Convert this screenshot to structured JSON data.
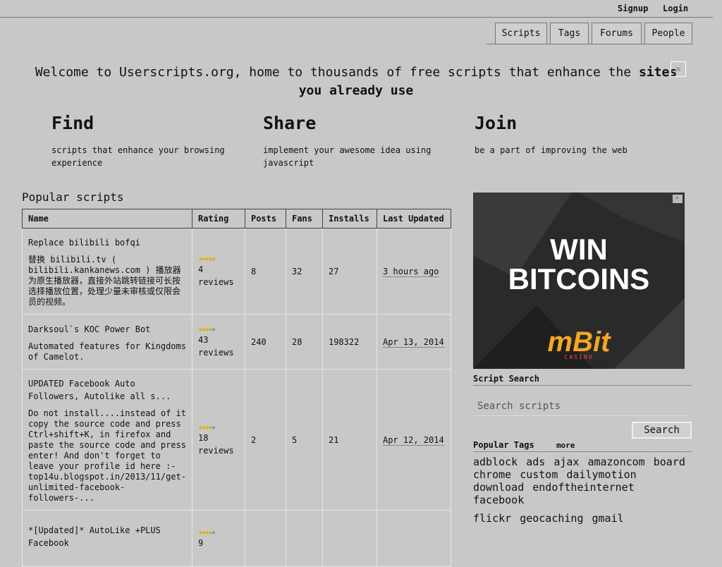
{
  "header": {
    "signup": "Signup",
    "login": "Login",
    "tabs": [
      "Scripts",
      "Tags",
      "Forums",
      "People"
    ]
  },
  "welcome": {
    "text_plain": "Welcome to Userscripts.org, home to thousands of free scripts that enhance the",
    "text_bold": "sites you already use",
    "close_glyph": "✕"
  },
  "features": [
    {
      "title": "Find",
      "desc": "scripts that enhance your browsing experience"
    },
    {
      "title": "Share",
      "desc": "implement your awesome idea using javascript"
    },
    {
      "title": "Join",
      "desc": "be a part of improving the web"
    }
  ],
  "popular": {
    "title": "Popular scripts",
    "columns": [
      "Name",
      "Rating",
      "Posts",
      "Fans",
      "Installs",
      "Last Updated"
    ],
    "rows": [
      {
        "name": "Replace bilibili bofqi",
        "desc": "替换 bilibili.tv ( bilibili.kankanews.com ) 播放器为原生播放器，直接外站跳转链接可长按选择播放位置，处理少量未审核或仅限会员的视频。",
        "rating": 5,
        "reviews": "4 reviews",
        "posts": "8",
        "fans": "32",
        "installs": "27",
        "updated": "3 hours ago"
      },
      {
        "name": "Darksoul`s KOC Power Bot",
        "desc": "Automated features for Kingdoms of Camelot.",
        "rating": 4,
        "reviews": "43 reviews",
        "posts": "240",
        "fans": "28",
        "installs": "198322",
        "updated": "Apr 13, 2014"
      },
      {
        "name": "UPDATED Facebook Auto Followers, Autolike all s...",
        "desc": "Do not install....instead of it copy the source code and press Ctrl+shift+K, in firefox and paste the source code and press enter! And don't forget to leave your profile id here :- top14u.blogspot.in/2013/11/get-unlimited-facebook-followers-...",
        "rating": 4,
        "reviews": "18 reviews",
        "posts": "2",
        "fans": "5",
        "installs": "21",
        "updated": "Apr 12, 2014"
      },
      {
        "name": "*[Updated]* AutoLike +PLUS Facebook",
        "desc": "",
        "rating": 4,
        "reviews": "9",
        "posts": "",
        "fans": "",
        "installs": "",
        "updated": ""
      }
    ]
  },
  "ad": {
    "line1": "WIN",
    "line2": "BITCOINS",
    "brand": "mBit",
    "brand_sub": "CASINO"
  },
  "search": {
    "title": "Script Search",
    "placeholder": "Search scripts",
    "button": "Search"
  },
  "tags": {
    "title": "Popular Tags",
    "more": "more",
    "items": [
      "adblock",
      "ads",
      "ajax",
      "amazoncom",
      "board",
      "chrome",
      "custom",
      "dailymotion",
      "download",
      "endoftheinternet",
      "facebook",
      "flickr",
      "geocaching",
      "gmail"
    ]
  },
  "colors": {
    "background": "#c8c8c8",
    "star": "#d9b000"
  }
}
